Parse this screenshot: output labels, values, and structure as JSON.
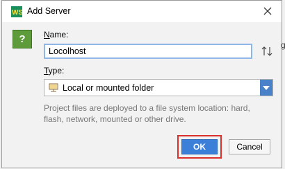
{
  "window": {
    "title": "Add Server",
    "icon": "webstorm-ws-icon",
    "close_icon": "close-x-icon"
  },
  "help": {
    "label": "?"
  },
  "form": {
    "name_label_accel": "N",
    "name_label_rest": "ame:",
    "name_value": "Locolhost",
    "swap_icon": "up-down-arrows-icon",
    "type_label_accel": "T",
    "type_label_rest": "ype:",
    "type_selected": "Local or mounted folder",
    "type_icon": "folder-icon",
    "description": "Project files are deployed to a file system location: hard, flash, network, mounted or other drive."
  },
  "buttons": {
    "ok": "OK",
    "cancel": "Cancel"
  },
  "edge": {
    "clipped_char": "g"
  },
  "colors": {
    "accent": "#3c7fd9",
    "help_green": "#5e9c3b",
    "highlight_red": "#d9302c",
    "dropdown_blue": "#4a82c9"
  }
}
